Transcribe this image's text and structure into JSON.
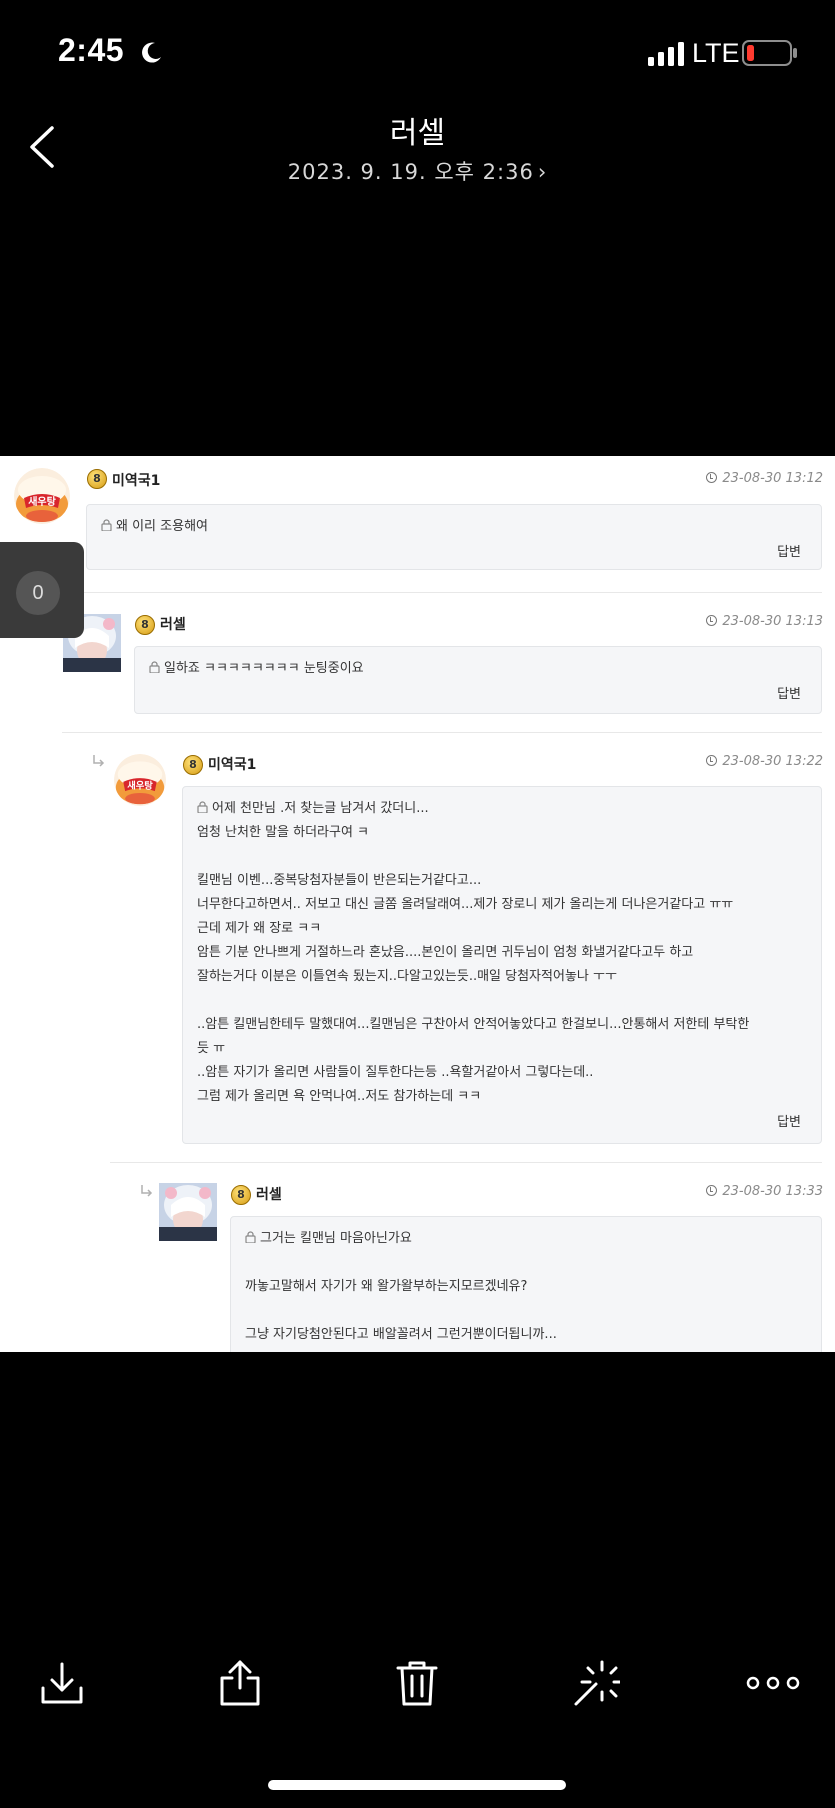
{
  "status_bar": {
    "time": "2:45",
    "network": "LTE",
    "battery_color": "#ff3b30"
  },
  "header": {
    "title": "러셀",
    "date": "2023. 9. 19. 오후 2:36",
    "date_chevron": "›"
  },
  "overlay": {
    "counter": "0"
  },
  "comments": [
    {
      "author": "미역국1",
      "level": "8",
      "time": "23-08-30 13:12",
      "lines": [
        "왜 이리 조용해여"
      ],
      "reply_label": "답변"
    },
    {
      "author": "러셀",
      "level": "8",
      "time": "23-08-30 13:13",
      "lines": [
        "일하죠 ㅋㅋㅋㅋㅋㅋㅋㅋ 눈팅중이요"
      ],
      "reply_label": "답변"
    },
    {
      "author": "미역국1",
      "level": "8",
      "time": "23-08-30 13:22",
      "lines": [
        "어제 천만님 .저 찾는글 남겨서 갔더니...",
        "엄청 난처한 말을 하더라구여 ㅋ",
        "",
        "킬맨님 이벤...중복당첨자분들이 반은되는거같다고...",
        "너무한다고하면서.. 저보고 대신 글쫌 올려달래여...제가 장로니 제가 올리는게 더나은거같다고 ㅠㅠ",
        "근데 제가 왜 장로 ㅋㅋ",
        "암튼 기분 안나쁘게 거절하느라 혼났음....본인이 올리면 귀두님이 엄청 화낼거같다고두 하고",
        "잘하는거다 이분은 이틀연속 됬는지..다알고있는듯..매일 당첨자적어놓나 ㅜㅜ",
        "",
        "..암튼 킬맨님한테두 말했대여...킬맨님은 구찬아서 안적어놓았다고 한걸보니...안통해서 저한테 부탁한",
        "듯 ㅠ",
        "..암튼 자기가 올리면 사람들이 질투한다는등 ..욕할거같아서 그렇다는데..",
        "그럼 제가 올리면 욕 안먹나여..저도 참가하는데 ㅋㅋ"
      ],
      "reply_label": "답변"
    },
    {
      "author": "러셀",
      "level": "8",
      "time": "23-08-30 13:33",
      "lines": [
        "그거는 킬맨님 마음아닌가요",
        "",
        "까놓고말해서 자기가 왜 왈가왈부하는지모르겠네유?",
        "",
        "그냥 자기당첨안된다고 배알꼴려서 그런거뿐이더됩니까..."
      ],
      "reply_label": ""
    }
  ],
  "thumbnails": {
    "noodle_label": "새우탕"
  },
  "toolbar": {
    "items": [
      "download-icon",
      "share-icon",
      "trash-icon",
      "magic-wand-icon",
      "more-icon"
    ]
  }
}
